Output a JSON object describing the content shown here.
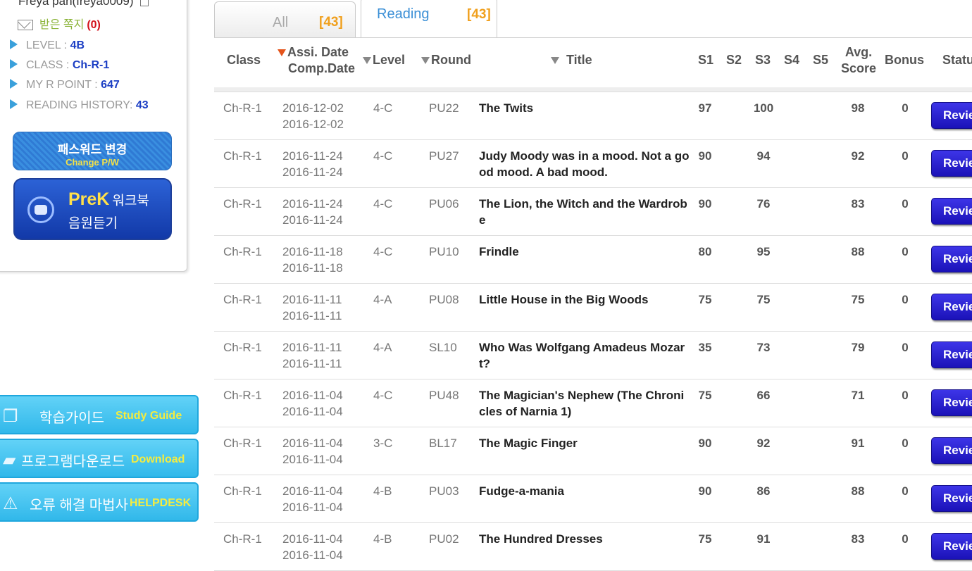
{
  "user": {
    "name": "Freya pan(freya0009)",
    "messages_label": "받은 쪽지",
    "messages_count": "(0)",
    "info": [
      {
        "label": "LEVEL : ",
        "value": "4B"
      },
      {
        "label": "CLASS : ",
        "value": "Ch-R-1"
      },
      {
        "label": "MY R POINT : ",
        "value": "647"
      },
      {
        "label": "READING HISTORY: ",
        "value": "43"
      }
    ]
  },
  "buttons": {
    "change_pw_ko": "패스워드 변경",
    "change_pw_en": "Change P/W",
    "prek_title": "PreK",
    "prek_sub": "워크북",
    "prek_line2": "음원듣기",
    "study_guide_ko": "학습가이드",
    "study_guide_en": "Study Guide",
    "download_ko": "프로그램다운로드",
    "download_en": "Download",
    "helpdesk_ko": "오류 해결 마법사",
    "helpdesk_en": "HELPDESK",
    "review": "Review"
  },
  "tabs": [
    {
      "label": "All",
      "count": "[43]"
    },
    {
      "label": "Reading",
      "count": "[43]"
    }
  ],
  "table": {
    "headers": {
      "class": "Class",
      "assi_date": "Assi. Date",
      "comp_date": "Comp.Date",
      "level": "Level",
      "round": "Round",
      "title": "Title",
      "s1": "S1",
      "s2": "S2",
      "s3": "S3",
      "s4": "S4",
      "s5": "S5",
      "avg1": "Avg.",
      "avg2": "Score",
      "bonus": "Bonus",
      "status": "Status"
    },
    "rows": [
      {
        "cls": "Ch-R-1",
        "assi": "2016-12-02",
        "comp": "2016-12-02",
        "level": "4-C",
        "round": "PU22",
        "title": "The Twits",
        "s1": "97",
        "s2": "",
        "s3": "100",
        "s4": "",
        "s5": "",
        "avg": "98",
        "bonus": "0"
      },
      {
        "cls": "Ch-R-1",
        "assi": "2016-11-24",
        "comp": "2016-11-24",
        "level": "4-C",
        "round": "PU27",
        "title": "Judy Moody was in a mood. Not a good mood. A bad mood.",
        "s1": "90",
        "s2": "",
        "s3": "94",
        "s4": "",
        "s5": "",
        "avg": "92",
        "bonus": "0"
      },
      {
        "cls": "Ch-R-1",
        "assi": "2016-11-24",
        "comp": "2016-11-24",
        "level": "4-C",
        "round": "PU06",
        "title": "The Lion, the Witch and the Wardrobe",
        "s1": "90",
        "s2": "",
        "s3": "76",
        "s4": "",
        "s5": "",
        "avg": "83",
        "bonus": "0"
      },
      {
        "cls": "Ch-R-1",
        "assi": "2016-11-18",
        "comp": "2016-11-18",
        "level": "4-C",
        "round": "PU10",
        "title": "Frindle",
        "s1": "80",
        "s2": "",
        "s3": "95",
        "s4": "",
        "s5": "",
        "avg": "88",
        "bonus": "0"
      },
      {
        "cls": "Ch-R-1",
        "assi": "2016-11-11",
        "comp": "2016-11-11",
        "level": "4-A",
        "round": "PU08",
        "title": "Little House in the Big Woods",
        "s1": "75",
        "s2": "",
        "s3": "75",
        "s4": "",
        "s5": "",
        "avg": "75",
        "bonus": "0"
      },
      {
        "cls": "Ch-R-1",
        "assi": "2016-11-11",
        "comp": "2016-11-11",
        "level": "4-A",
        "round": "SL10",
        "title": "Who Was Wolfgang Amadeus Mozart?",
        "s1": "35",
        "s2": "",
        "s3": "73",
        "s4": "",
        "s5": "",
        "avg": "79",
        "bonus": "0"
      },
      {
        "cls": "Ch-R-1",
        "assi": "2016-11-04",
        "comp": "2016-11-04",
        "level": "4-C",
        "round": "PU48",
        "title": "The Magician's Nephew (The Chronicles of Narnia 1)",
        "s1": "75",
        "s2": "",
        "s3": "66",
        "s4": "",
        "s5": "",
        "avg": "71",
        "bonus": "0"
      },
      {
        "cls": "Ch-R-1",
        "assi": "2016-11-04",
        "comp": "2016-11-04",
        "level": "3-C",
        "round": "BL17",
        "title": "The Magic Finger",
        "s1": "90",
        "s2": "",
        "s3": "92",
        "s4": "",
        "s5": "",
        "avg": "91",
        "bonus": "0"
      },
      {
        "cls": "Ch-R-1",
        "assi": "2016-11-04",
        "comp": "2016-11-04",
        "level": "4-B",
        "round": "PU03",
        "title": "Fudge-a-mania",
        "s1": "90",
        "s2": "",
        "s3": "86",
        "s4": "",
        "s5": "",
        "avg": "88",
        "bonus": "0"
      },
      {
        "cls": "Ch-R-1",
        "assi": "2016-11-04",
        "comp": "2016-11-04",
        "level": "4-B",
        "round": "PU02",
        "title": "The Hundred Dresses",
        "s1": "75",
        "s2": "",
        "s3": "91",
        "s4": "",
        "s5": "",
        "avg": "83",
        "bonus": "0"
      }
    ]
  }
}
